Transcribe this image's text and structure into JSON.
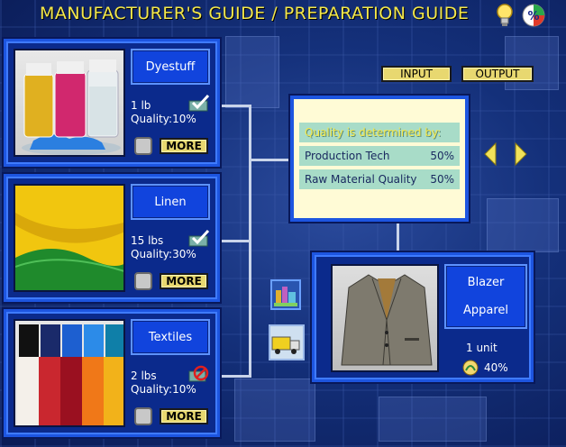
{
  "header": {
    "title": "MANUFACTURER'S GUIDE / PREPARATION GUIDE",
    "hint_icon": "lightbulb-icon",
    "percent_icon": "percent-icon"
  },
  "io": {
    "input_label": "INPUT",
    "output_label": "OUTPUT"
  },
  "inputs": [
    {
      "name": "Dyestuff",
      "amount": "1 lb",
      "quality_label": "Quality:",
      "quality": "10%",
      "more_label": "MORE",
      "status_icon": "available-icon"
    },
    {
      "name": "Linen",
      "amount": "15 lbs",
      "quality_label": "Quality:",
      "quality": "30%",
      "more_label": "MORE",
      "status_icon": "available-icon"
    },
    {
      "name": "Textiles",
      "amount": "2 lbs",
      "quality_label": "Quality:",
      "quality": "10%",
      "more_label": "MORE",
      "status_icon": "unavailable-icon"
    }
  ],
  "quality_panel": {
    "heading": "Quality is determined by:",
    "rows": [
      {
        "label": "Production Tech",
        "value": "50%"
      },
      {
        "label": "Raw Material Quality",
        "value": "50%"
      }
    ]
  },
  "output": {
    "name": "Blazer",
    "category": "Apparel",
    "amount": "1 unit",
    "quality": "40%"
  },
  "colors": {
    "panel_bg": "#0b2a8c",
    "panel_border": "#1d55e0",
    "title": "#f4e84a",
    "button": "#e8d870",
    "quality_bg": "#fffbd6",
    "quality_row": "#a8dcc8"
  }
}
